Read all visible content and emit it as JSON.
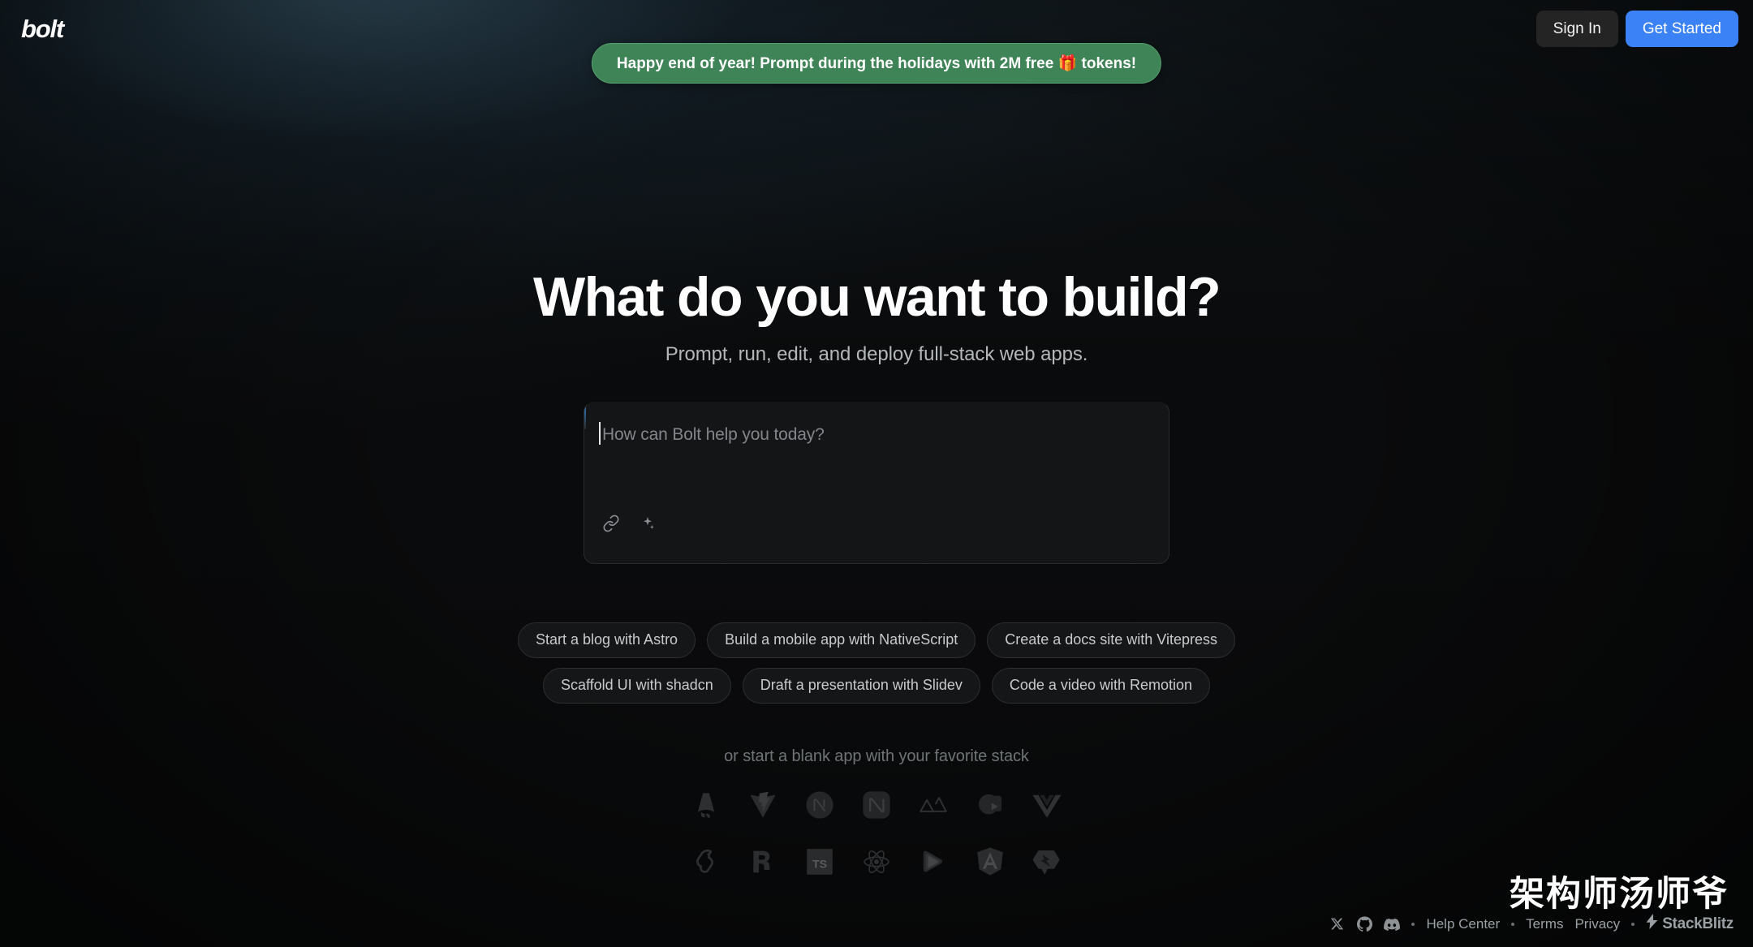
{
  "header": {
    "logo": "bolt",
    "sign_in_label": "Sign In",
    "get_started_label": "Get Started"
  },
  "promo": {
    "text": "Happy end of year! Prompt during the holidays with 2M free 🎁 tokens!"
  },
  "hero": {
    "headline": "What do you want to build?",
    "subhead": "Prompt, run, edit, and deploy full-stack web apps."
  },
  "prompt": {
    "placeholder": "How can Bolt help you today?",
    "value": "",
    "tools": [
      {
        "name": "attach-icon",
        "label": "Attach file"
      },
      {
        "name": "enhance-prompt-icon",
        "label": "Enhance prompt"
      }
    ]
  },
  "suggestions": [
    {
      "label": "Start a blog with Astro"
    },
    {
      "label": "Build a mobile app with NativeScript"
    },
    {
      "label": "Create a docs site with Vitepress"
    },
    {
      "label": "Scaffold UI with shadcn"
    },
    {
      "label": "Draft a presentation with Slidev"
    },
    {
      "label": "Code a video with Remotion"
    }
  ],
  "stacks": {
    "label": "or start a blank app with your favorite stack",
    "items": [
      {
        "name": "astro-icon",
        "label": "Astro"
      },
      {
        "name": "vite-icon",
        "label": "Vite"
      },
      {
        "name": "nextjs-icon",
        "label": "Next.js"
      },
      {
        "name": "nuxt-square-icon",
        "label": "Nuxt"
      },
      {
        "name": "nuxt-icon",
        "label": "Nuxt"
      },
      {
        "name": "qwik-circle-icon",
        "label": "Qwik"
      },
      {
        "name": "vue-icon",
        "label": "Vue"
      },
      {
        "name": "svelte-icon",
        "label": "Svelte"
      },
      {
        "name": "remix-icon",
        "label": "Remix"
      },
      {
        "name": "typescript-icon",
        "label": "TypeScript"
      },
      {
        "name": "react-icon",
        "label": "React"
      },
      {
        "name": "solid-icon",
        "label": "SolidJS"
      },
      {
        "name": "angular-icon",
        "label": "Angular"
      },
      {
        "name": "qwik-icon",
        "label": "Qwik"
      }
    ]
  },
  "footer": {
    "social": [
      {
        "name": "x-icon",
        "label": "X"
      },
      {
        "name": "github-icon",
        "label": "GitHub"
      },
      {
        "name": "discord-icon",
        "label": "Discord"
      }
    ],
    "links": [
      {
        "label": "Help Center"
      },
      {
        "label": "Terms"
      },
      {
        "label": "Privacy"
      }
    ],
    "brand": "StackBlitz"
  },
  "watermark": {
    "text": "架构师汤师爷"
  },
  "colors": {
    "accent_blue": "#3b82f6",
    "promo_green": "#3f8456",
    "page_bg": "#0b0c0d",
    "prompt_bg": "#141516"
  }
}
